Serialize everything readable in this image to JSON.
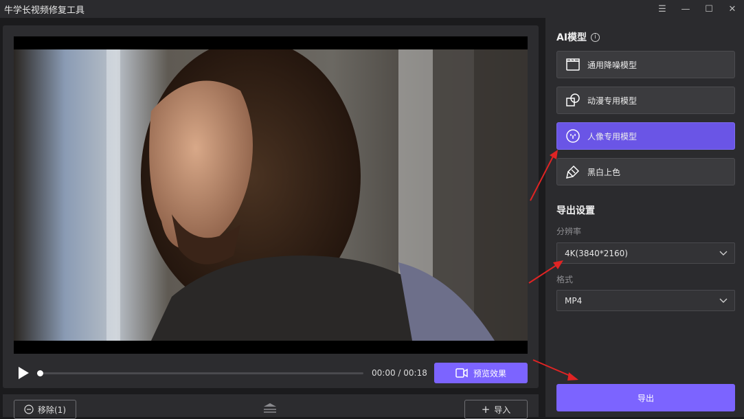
{
  "app": {
    "title": "牛学长视频修复工具"
  },
  "window_controls": {
    "menu": "☰",
    "minimize": "—",
    "maximize": "☐",
    "close": "✕"
  },
  "player": {
    "time": "00:00 / 00:18",
    "progress": 0.0,
    "preview_label": "预览效果"
  },
  "bottom_bar": {
    "remove_label": "移除(1)",
    "import_label": "导入"
  },
  "ai_models": {
    "heading": "AI模型",
    "items": [
      {
        "label": "通用降噪模型",
        "icon": "clapperboard-icon",
        "active": false
      },
      {
        "label": "动漫专用模型",
        "icon": "shapes-icon",
        "active": false
      },
      {
        "label": "人像专用模型",
        "icon": "face-icon",
        "active": true
      },
      {
        "label": "黑白上色",
        "icon": "paint-brush-icon",
        "active": false
      }
    ]
  },
  "export_settings": {
    "heading": "导出设置",
    "resolution_label": "分辨率",
    "resolution_value": "4K(3840*2160)",
    "format_label": "格式",
    "format_value": "MP4",
    "export_label": "导出"
  },
  "colors": {
    "accent": "#7c64ff",
    "active_model": "#6a55e6",
    "annotation_arrow": "#e02424"
  }
}
